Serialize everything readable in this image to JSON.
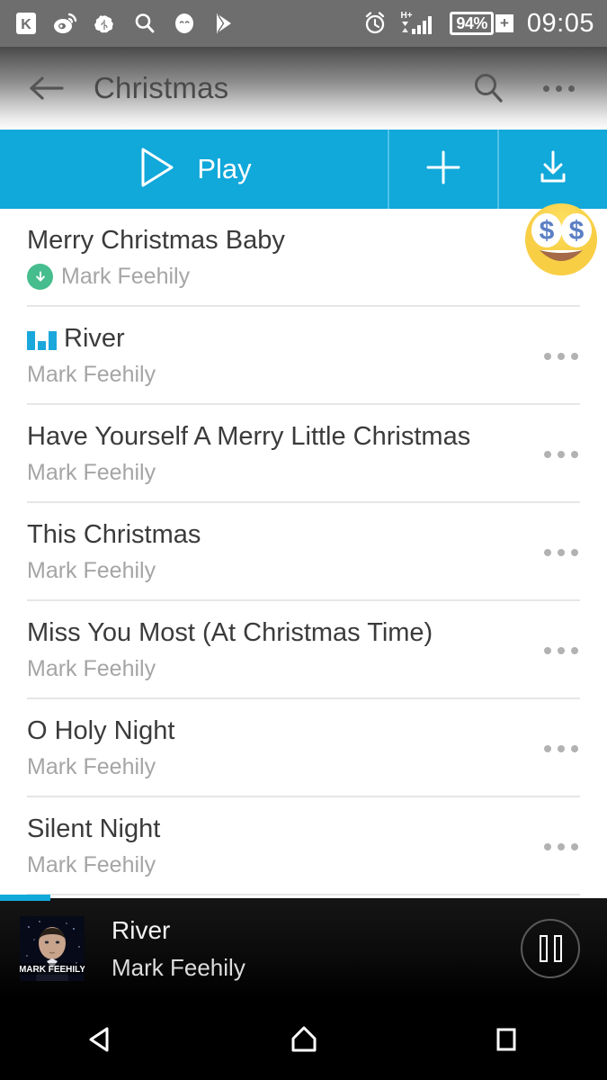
{
  "status_bar": {
    "left_icons": [
      {
        "name": "kugou-app-icon",
        "glyph": "K"
      },
      {
        "name": "weibo-icon",
        "glyph": "weibo"
      },
      {
        "name": "brain-cloud-icon",
        "glyph": "brain"
      },
      {
        "name": "search-status-icon",
        "glyph": "search"
      },
      {
        "name": "smiley-face-icon",
        "glyph": "face"
      },
      {
        "name": "play-store-icon",
        "glyph": "playstore"
      }
    ],
    "alarm_icon": "alarm-clock-icon",
    "network_type": "H+",
    "battery_percent": "94%",
    "battery_charging_glyph": "+",
    "clock": "09:05"
  },
  "app_bar": {
    "back_icon": "back-arrow-icon",
    "title": "Christmas",
    "search_icon": "search-icon",
    "overflow_icon": "overflow-menu-icon"
  },
  "action_bar": {
    "play_label": "Play",
    "play_icon": "play-triangle-icon",
    "add_icon": "plus-icon",
    "download_icon": "download-icon",
    "accent_color": "#11a8da"
  },
  "overlay": {
    "emoji_name": "money-mouth-face-emoji",
    "emoji_char": "🤑"
  },
  "songs": [
    {
      "title": "Merry Christmas Baby",
      "artist": "Mark Feehily",
      "downloaded": true,
      "playing": false
    },
    {
      "title": "River",
      "artist": "Mark Feehily",
      "downloaded": false,
      "playing": true
    },
    {
      "title": "Have Yourself A Merry Little Christmas",
      "artist": "Mark Feehily",
      "downloaded": false,
      "playing": false
    },
    {
      "title": "This Christmas",
      "artist": "Mark Feehily",
      "downloaded": false,
      "playing": false
    },
    {
      "title": "Miss You Most  (At Christmas Time)",
      "artist": "Mark Feehily",
      "downloaded": false,
      "playing": false
    },
    {
      "title": "O Holy Night",
      "artist": "Mark Feehily",
      "downloaded": false,
      "playing": false
    },
    {
      "title": "Silent Night",
      "artist": "Mark Feehily",
      "downloaded": false,
      "playing": false
    }
  ],
  "row_menu_icon": "row-overflow-icon",
  "download_badge_icon": "downloaded-check-icon",
  "equalizer_icon": "now-playing-equalizer-icon",
  "now_playing": {
    "title": "River",
    "artist": "Mark Feehily",
    "album_art_label": "MARK FEEHILY",
    "pause_icon": "pause-icon",
    "progress_color": "#11a8da"
  },
  "nav_bar": {
    "back": "nav-back-icon",
    "home": "nav-home-icon",
    "recents": "nav-recents-icon"
  },
  "colors": {
    "accent_blue": "#11a8da",
    "download_green": "#46bd8c",
    "status_gray": "#6e6e6e",
    "title_gray": "#4a4a4a",
    "subtitle_gray": "#a5a5a5"
  }
}
